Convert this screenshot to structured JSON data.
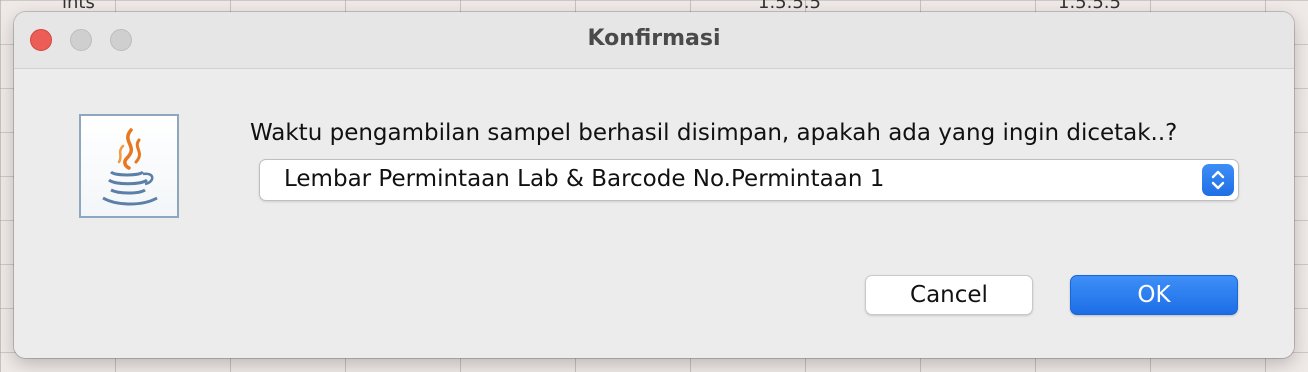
{
  "dialog": {
    "title": "Konfirmasi",
    "message": "Waktu pengambilan sampel berhasil disimpan, apakah ada yang ingin dicetak..?",
    "icon": "java-icon",
    "select": {
      "value": "Lembar Permintaan Lab & Barcode No.Permintaan 1"
    },
    "buttons": {
      "cancel": "Cancel",
      "ok": "OK"
    }
  },
  "background": {
    "text_left": "ints",
    "text_mid": "1.5.5.5",
    "text_right": "1.5.5.5"
  },
  "colors": {
    "accent": "#1f6fe5",
    "close": "#ec5d57",
    "dialog_bg": "#ececec"
  }
}
